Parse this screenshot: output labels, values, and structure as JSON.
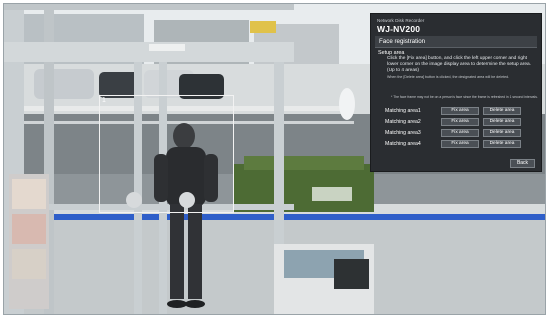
{
  "device": {
    "label": "Network Disk Recorder",
    "model": "WJ-NV200"
  },
  "panel": {
    "title": "Face registration",
    "setup_area_title": "Setup area",
    "instruction": "Click the [Fix area] button, and click the left upper corner and right lower corner on the image display area to determine the setup area. (Up to 4 areas)",
    "note_delete": "When the [Delete area] button is clicked, the designated area will be deleted.",
    "note_frame": "* The face frame may not be on a person's face since the frame is refreshed in 1 second intervals.",
    "rows": [
      {
        "label": "Matching area1",
        "fix": "Fix area",
        "delete": "Delete area"
      },
      {
        "label": "Matching area2",
        "fix": "Fix area",
        "delete": "Delete area"
      },
      {
        "label": "Matching area3",
        "fix": "Fix area",
        "delete": "Delete area"
      },
      {
        "label": "Matching area4",
        "fix": "Fix area",
        "delete": "Delete area"
      }
    ],
    "back_label": "Back"
  },
  "selection": {
    "number": "1"
  },
  "colors": {
    "panel_bg": "#2a2d31",
    "button_bg": "#4a4f55",
    "door_frame": "#c9cfd2",
    "floor_line": "#2f5fc9"
  }
}
